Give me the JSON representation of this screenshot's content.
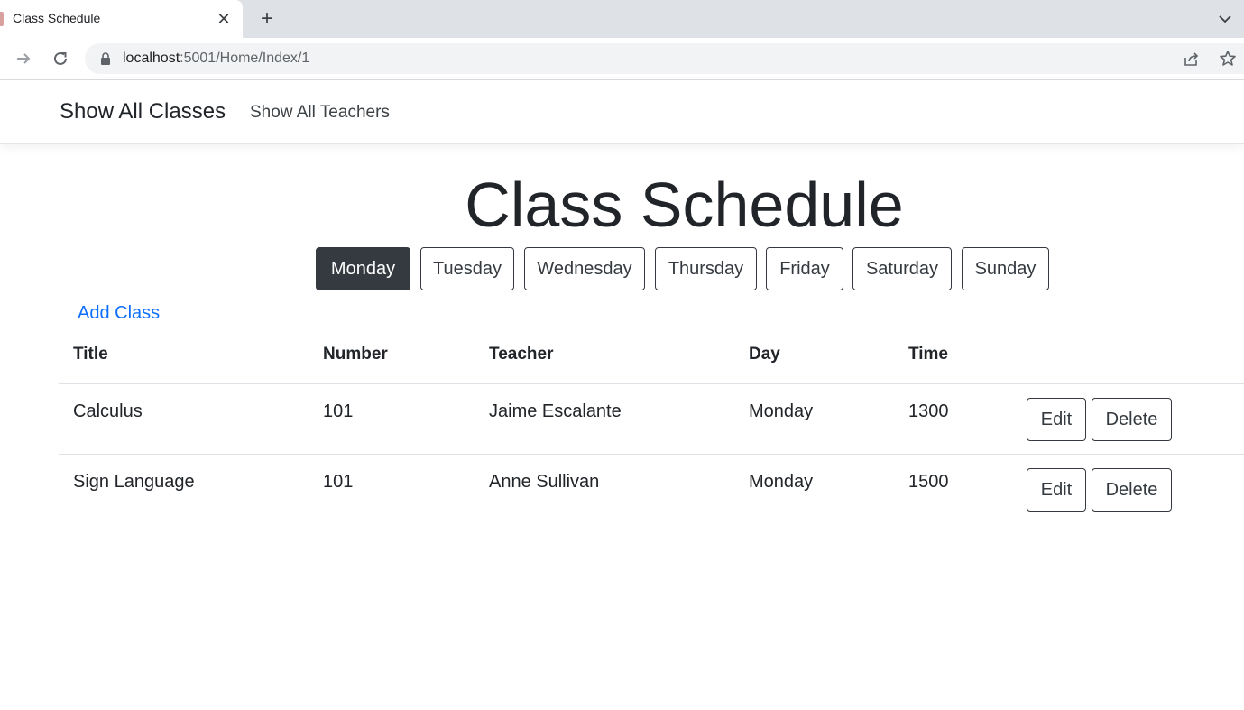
{
  "browser": {
    "tab_title": "Class Schedule",
    "url_host": "localhost",
    "url_rest": ":5001/Home/Index/1"
  },
  "nav": {
    "brand": "Show All Classes",
    "teachers_link": "Show All Teachers"
  },
  "page": {
    "title": "Class Schedule",
    "add_class": "Add Class"
  },
  "days": [
    {
      "label": "Monday",
      "active": true
    },
    {
      "label": "Tuesday",
      "active": false
    },
    {
      "label": "Wednesday",
      "active": false
    },
    {
      "label": "Thursday",
      "active": false
    },
    {
      "label": "Friday",
      "active": false
    },
    {
      "label": "Saturday",
      "active": false
    },
    {
      "label": "Sunday",
      "active": false
    }
  ],
  "table": {
    "headers": [
      "Title",
      "Number",
      "Teacher",
      "Day",
      "Time"
    ],
    "rows": [
      {
        "title": "Calculus",
        "number": "101",
        "teacher": "Jaime Escalante",
        "day": "Monday",
        "time": "1300",
        "edit": "Edit",
        "delete": "Delete"
      },
      {
        "title": "Sign Language",
        "number": "101",
        "teacher": "Anne Sullivan",
        "day": "Monday",
        "time": "1500",
        "edit": "Edit",
        "delete": "Delete"
      }
    ]
  },
  "colors": {
    "dark": "#343a40",
    "link": "#0d6efd"
  }
}
